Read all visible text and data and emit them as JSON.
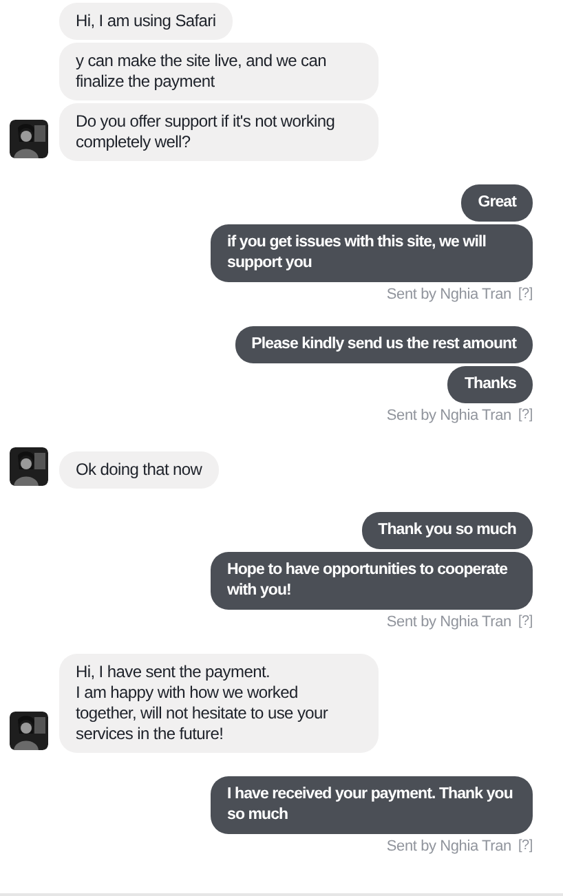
{
  "groups": [
    {
      "outgoing": false,
      "avatar": {
        "kind": "picture"
      },
      "messages": [
        "Hi, I am using Safari",
        "y can make the site live, and we can finalize the payment",
        "Do you offer support if it's not working completely well?"
      ]
    },
    {
      "outgoing": true,
      "messages": [
        "Great",
        "if you get issues with this site, we will support you"
      ],
      "sent_by": "Sent by Nghia Tran",
      "help": "[?]"
    },
    {
      "outgoing": true,
      "messages": [
        "Please kindly send us the rest amount",
        "Thanks"
      ],
      "sent_by": "Sent by Nghia Tran",
      "help": "[?]"
    },
    {
      "outgoing": false,
      "avatar": {
        "kind": "picture"
      },
      "messages": [
        "Ok doing that now"
      ]
    },
    {
      "outgoing": true,
      "messages": [
        "Thank you so much",
        "Hope to have opportunities to cooperate with you!"
      ],
      "sent_by": "Sent by Nghia Tran",
      "help": "[?]"
    },
    {
      "outgoing": false,
      "avatar": {
        "kind": "picture"
      },
      "messages": [
        "Hi, I have sent the payment.\nI am happy with how we worked together, will not hesitate to use your services in the future!"
      ]
    },
    {
      "outgoing": true,
      "messages": [
        "I have received your payment. Thank you so much"
      ],
      "sent_by": "Sent by Nghia Tran",
      "help": "[?]"
    }
  ]
}
